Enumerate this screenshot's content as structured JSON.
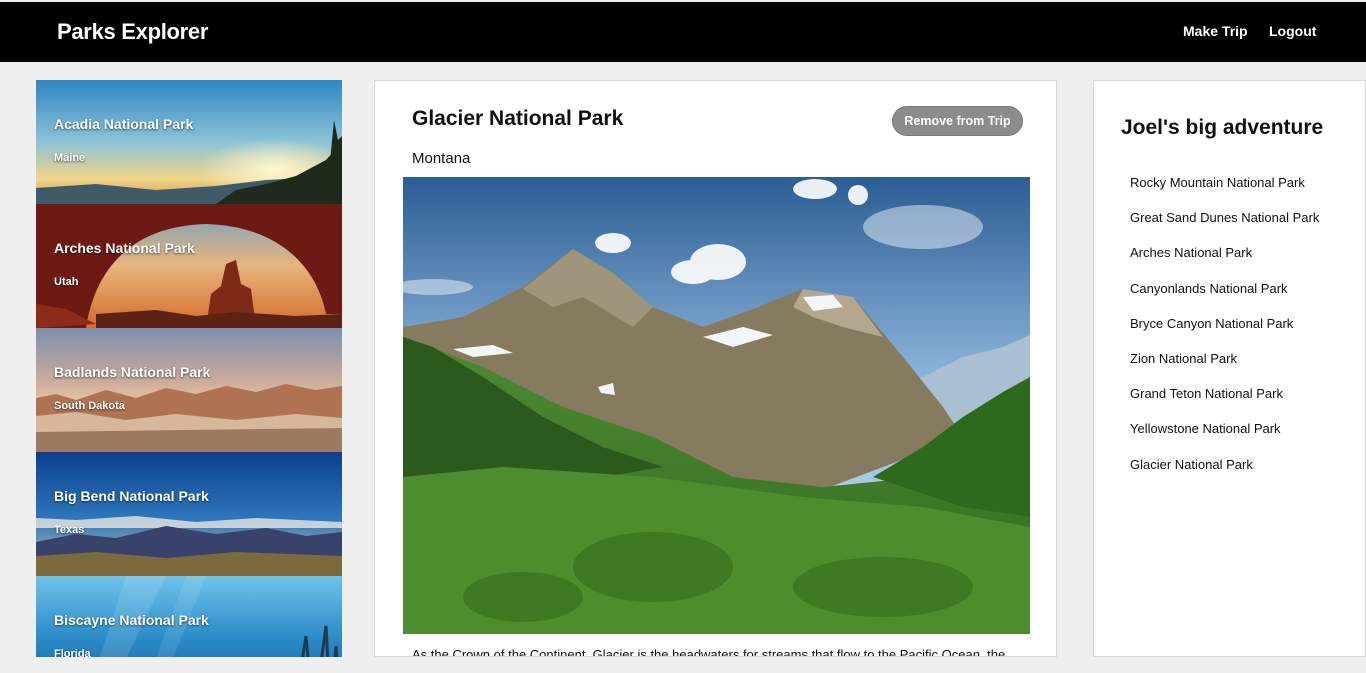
{
  "app": {
    "brand": "Parks Explorer"
  },
  "nav": {
    "make_trip": "Make Trip",
    "logout": "Logout"
  },
  "parks": [
    {
      "name": "Acadia National Park",
      "state": "Maine"
    },
    {
      "name": "Arches National Park",
      "state": "Utah"
    },
    {
      "name": "Badlands National Park",
      "state": "South Dakota"
    },
    {
      "name": "Big Bend National Park",
      "state": "Texas"
    },
    {
      "name": "Biscayne National Park",
      "state": "Florida"
    }
  ],
  "detail": {
    "title": "Glacier National Park",
    "state": "Montana",
    "remove_label": "Remove from Trip",
    "description": "As the Crown of the Continent, Glacier is the headwaters for streams that flow to the Pacific Ocean, the"
  },
  "trip": {
    "title": "Joel's big adventure",
    "items": [
      "Rocky Mountain National Park",
      "Great Sand Dunes National Park",
      "Arches National Park",
      "Canyonlands National Park",
      "Bryce Canyon National Park",
      "Zion National Park",
      "Grand Teton National Park",
      "Yellowstone National Park",
      "Glacier National Park"
    ]
  }
}
